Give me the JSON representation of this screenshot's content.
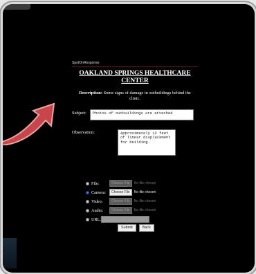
{
  "app": {
    "name": "SpotOnResponse"
  },
  "report": {
    "title": "OAKLAND SPRINGS HEALTHCARE CENTER",
    "description_label": "Description:",
    "description_text": "Some signs of damage in outbuildings behind the clinic."
  },
  "form": {
    "subject_label": "Subject:",
    "subject_value": "Photos of outbuildings are attached",
    "observation_label": "Observation:",
    "observation_value": "Approximately 12 feet of linear displacement for building.",
    "media": [
      {
        "label": "File:",
        "selected": false,
        "enabled": false,
        "button": "Choose File",
        "status": "No file chosen"
      },
      {
        "label": "Camera:",
        "selected": true,
        "enabled": true,
        "button": "Choose File",
        "status": "No file chosen"
      },
      {
        "label": "Video:",
        "selected": false,
        "enabled": false,
        "button": "Choose File",
        "status": "No file chosen"
      },
      {
        "label": "Audio:",
        "selected": false,
        "enabled": false,
        "button": "Choose File",
        "status": "No file chosen"
      }
    ],
    "url_label": "URL:",
    "submit_label": "Submit",
    "back_label": "Back"
  },
  "colors": {
    "background": "#000000",
    "arrow": "#c8464b",
    "frame": "#d9d9d9"
  }
}
